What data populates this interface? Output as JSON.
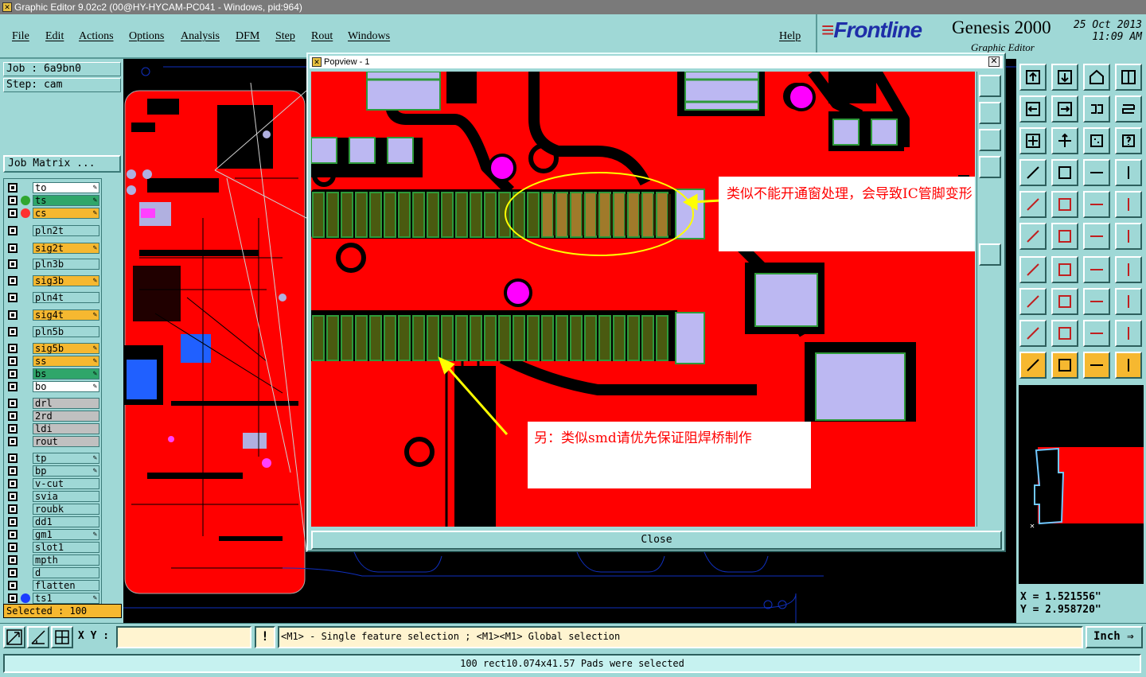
{
  "window": {
    "title": "Graphic Editor 9.02c2 (00@HY-HYCAM-PC041 - Windows, pid:964)"
  },
  "menu": {
    "items": [
      "File",
      "Edit",
      "Actions",
      "Options",
      "Analysis",
      "DFM",
      "Step",
      "Rout",
      "Windows"
    ],
    "help": "Help"
  },
  "brand": {
    "logo": "Frontline",
    "product": "Genesis 2000",
    "subtitle": "Graphic Editor",
    "date": "25 Oct 2013",
    "time": "11:09 AM"
  },
  "job": {
    "job_label": "Job : 6a9bn0",
    "step_label": "Step: cam",
    "matrix_button": "Job Matrix ..."
  },
  "layers": [
    {
      "name": "to",
      "bg": "#ffffff",
      "dot": "",
      "pen": true
    },
    {
      "name": "ts",
      "bg": "#2fa66a",
      "dot": "#2fa62f",
      "pen": true
    },
    {
      "name": "cs",
      "bg": "#f6b830",
      "dot": "#ff3030",
      "pen": true
    },
    {
      "name": "pln2t",
      "bg": "#9fd8d6",
      "dot": "",
      "pen": false
    },
    {
      "name": "sig2t",
      "bg": "#f6b830",
      "dot": "",
      "pen": true
    },
    {
      "name": "pln3b",
      "bg": "#9fd8d6",
      "dot": "",
      "pen": false
    },
    {
      "name": "sig3b",
      "bg": "#f6b830",
      "dot": "",
      "pen": true
    },
    {
      "name": "pln4t",
      "bg": "#9fd8d6",
      "dot": "",
      "pen": false
    },
    {
      "name": "sig4t",
      "bg": "#f6b830",
      "dot": "",
      "pen": true
    },
    {
      "name": "pln5b",
      "bg": "#9fd8d6",
      "dot": "",
      "pen": false
    },
    {
      "name": "sig5b",
      "bg": "#f6b830",
      "dot": "",
      "pen": true
    },
    {
      "name": "ss",
      "bg": "#f6b830",
      "dot": "",
      "pen": true
    },
    {
      "name": "bs",
      "bg": "#2fa66a",
      "dot": "",
      "pen": true
    },
    {
      "name": "bo",
      "bg": "#ffffff",
      "dot": "",
      "pen": true
    },
    {
      "name": "drl",
      "bg": "#c0c0c0",
      "dot": "",
      "pen": false
    },
    {
      "name": "2rd",
      "bg": "#c0c0c0",
      "dot": "",
      "pen": false
    },
    {
      "name": "ldi",
      "bg": "#c0c0c0",
      "dot": "",
      "pen": false
    },
    {
      "name": "rout",
      "bg": "#c0c0c0",
      "dot": "",
      "pen": false
    },
    {
      "name": "tp",
      "bg": "#9fd8d6",
      "dot": "",
      "pen": true
    },
    {
      "name": "bp",
      "bg": "#9fd8d6",
      "dot": "",
      "pen": true
    },
    {
      "name": "v-cut",
      "bg": "#9fd8d6",
      "dot": "",
      "pen": false
    },
    {
      "name": "svia",
      "bg": "#9fd8d6",
      "dot": "",
      "pen": false
    },
    {
      "name": "roubk",
      "bg": "#9fd8d6",
      "dot": "",
      "pen": false
    },
    {
      "name": "dd1",
      "bg": "#9fd8d6",
      "dot": "",
      "pen": false
    },
    {
      "name": "gm1",
      "bg": "#9fd8d6",
      "dot": "",
      "pen": true
    },
    {
      "name": "slot1",
      "bg": "#9fd8d6",
      "dot": "",
      "pen": false
    },
    {
      "name": "mpth",
      "bg": "#9fd8d6",
      "dot": "",
      "pen": false
    },
    {
      "name": "d",
      "bg": "#9fd8d6",
      "dot": "",
      "pen": false
    },
    {
      "name": "flatten",
      "bg": "#9fd8d6",
      "dot": "",
      "pen": false
    },
    {
      "name": "ts1",
      "bg": "#9fd8d6",
      "dot": "#1a3cff",
      "pen": true
    }
  ],
  "selected": "Selected : 100",
  "popview": {
    "title": "Popview - 1",
    "close_label": "Close",
    "note1": "类似不能开通窗处理，会导致IC管脚变形",
    "note2": "另：类似smd请优先保证阻焊桥制作"
  },
  "coords": {
    "x": "X = 1.521556\"",
    "y": "Y = 2.958720\""
  },
  "command": {
    "xy_label": "X Y :",
    "xy_value": "",
    "hint": "<M1> - Single feature selection ; <M1><M1> Global selection",
    "units": "Inch"
  },
  "status": "100 rect10.074x41.57 Pads were selected",
  "colors": {
    "panel": "#9fd8d6",
    "copper": "#ff0000",
    "pad": "#b8b8f0",
    "accent": "#f6b830"
  }
}
